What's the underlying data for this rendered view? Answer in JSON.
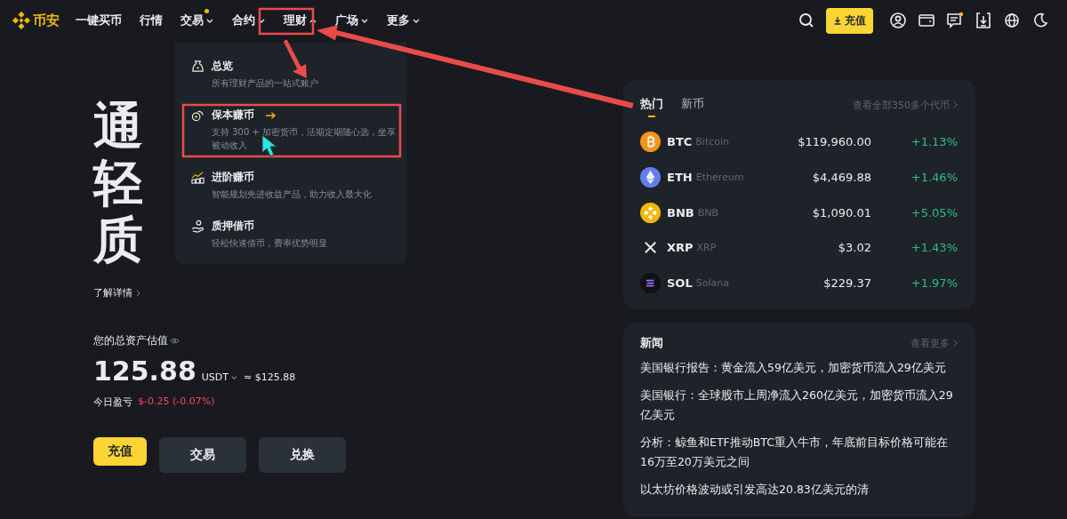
{
  "logo": {
    "text": "币安"
  },
  "nav": [
    {
      "label": "一键买币",
      "has_menu": false,
      "badge": false
    },
    {
      "label": "行情",
      "has_menu": false,
      "badge": false
    },
    {
      "label": "交易",
      "has_menu": true,
      "expanded": false,
      "badge": true
    },
    {
      "label": "合约",
      "has_menu": true,
      "expanded": false,
      "badge": false
    },
    {
      "label": "理财",
      "has_menu": true,
      "expanded": true,
      "badge": false
    },
    {
      "label": "广场",
      "has_menu": true,
      "expanded": false,
      "badge": false
    },
    {
      "label": "更多",
      "has_menu": true,
      "expanded": false,
      "badge": false
    }
  ],
  "deposit_button": "充值",
  "menu": [
    {
      "title": "总览",
      "desc": "所有理财产品的一站式账户",
      "hovered": false
    },
    {
      "title": "保本赚币",
      "desc": "支持 300 + 加密货币，活期定期随心选，坐享被动收入",
      "hovered": true
    },
    {
      "title": "进阶赚币",
      "desc": "智能规划先进收益产品，助力收入最大化",
      "hovered": false
    },
    {
      "title": "质押借币",
      "desc": "轻松快速借币，费率优势明显",
      "hovered": false
    }
  ],
  "hero": {
    "lines": [
      "通",
      "轻",
      "质"
    ],
    "learn_more": "了解详情"
  },
  "assets": {
    "label": "您的总资产估值",
    "amount": "125.88",
    "unit": "USDT",
    "approx": "≈ $125.88",
    "pnl_label": "今日盈亏",
    "pnl": "$-0.25 (-0.07%)"
  },
  "actions": [
    {
      "label": "充值",
      "primary": true
    },
    {
      "label": "交易",
      "primary": false
    },
    {
      "label": "兑换",
      "primary": false
    }
  ],
  "market": {
    "tabs": [
      {
        "label": "热门",
        "selected": true
      },
      {
        "label": "新币",
        "selected": false
      }
    ],
    "view_all": "查看全部350多个代币",
    "rows": [
      {
        "symbol": "BTC",
        "name": "Bitcoin",
        "price": "$119,960.00",
        "change": "+1.13%"
      },
      {
        "symbol": "ETH",
        "name": "Ethereum",
        "price": "$4,469.88",
        "change": "+1.46%"
      },
      {
        "symbol": "BNB",
        "name": "BNB",
        "price": "$1,090.01",
        "change": "+5.05%"
      },
      {
        "symbol": "XRP",
        "name": "XRP",
        "price": "$3.02",
        "change": "+1.43%"
      },
      {
        "symbol": "SOL",
        "name": "Solana",
        "price": "$229.37",
        "change": "+1.97%"
      }
    ]
  },
  "news": {
    "title": "新闻",
    "more": "查看更多",
    "items": [
      "美国银行报告：黄金流入59亿美元，加密货币流入29亿美元",
      "美国银行：全球股市上周净流入260亿美元，加密货币流入29亿美元",
      "分析：鲸鱼和ETF推动BTC重入牛市，年底前目标价格可能在16万至20万美元之间",
      "以太坊价格波动或引发高达20.83亿美元的清"
    ]
  }
}
